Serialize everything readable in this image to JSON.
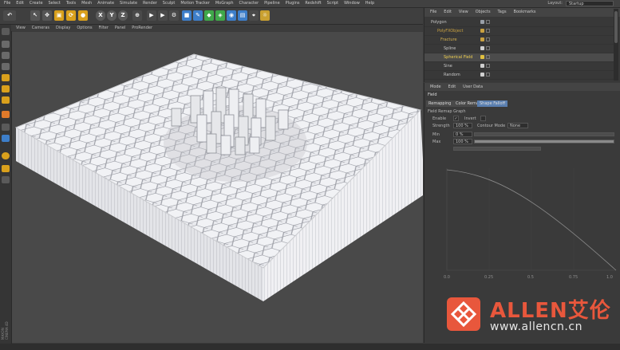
{
  "menubar": {
    "items": [
      "File",
      "Edit",
      "Create",
      "Select",
      "Tools",
      "Mesh",
      "Animate",
      "Simulate",
      "Render",
      "Sculpt",
      "Motion Tracker",
      "MoGraph",
      "Character",
      "Pipeline",
      "Plugins",
      "Redshift",
      "Script",
      "Window",
      "Help"
    ],
    "layout_label": "Layout:",
    "layout_value": "Startup"
  },
  "toolbar": {
    "axis_labels": [
      "X",
      "Y",
      "Z"
    ]
  },
  "viewport_menu": {
    "items": [
      "View",
      "Cameras",
      "Display",
      "Options",
      "Filter",
      "Panel",
      "ProRender"
    ]
  },
  "object_manager": {
    "menu": [
      "File",
      "Edit",
      "View",
      "Objects",
      "Tags",
      "Bookmarks"
    ],
    "objects": [
      {
        "name": "Polygon",
        "color": "#9aa0a8"
      },
      {
        "name": "PolyFXObject",
        "color": "#c8a040"
      },
      {
        "name": "Fracture",
        "color": "#c8a040"
      },
      {
        "name": "Spline",
        "color": "#d0d0d0"
      },
      {
        "name": "Spherical Field",
        "color": "#e0c040"
      },
      {
        "name": "Sine",
        "color": "#cfcfcf"
      },
      {
        "name": "Random",
        "color": "#cfcfcf"
      }
    ]
  },
  "attribute_manager": {
    "menu": [
      "Mode",
      "Edit",
      "User Data"
    ],
    "object_title": "Field",
    "tabs": [
      "Remapping",
      "Color Remap",
      "Shape Falloff"
    ],
    "section": "Field Remap Graph",
    "fields": [
      {
        "label": "Enable",
        "value": "✓"
      },
      {
        "label": "Invert",
        "value": ""
      },
      {
        "label": "Strength",
        "value": "100 %"
      },
      {
        "label": "Contour Mode",
        "value": "None"
      },
      {
        "label": "Min",
        "value": "0 %"
      },
      {
        "label": "Max",
        "value": "100 %"
      }
    ],
    "graph_ticks": [
      "0.0",
      "0.25",
      "0.5",
      "0.75",
      "1.0"
    ]
  },
  "watermark": {
    "brand": "ALLEN艾伦",
    "url": "www.allencn.cn"
  },
  "side_brand": "MAXON CINEMA 4D",
  "colors": {
    "accent": "#e8573c",
    "tool_active": "#d9a01c",
    "tool_blue": "#3d7ec9",
    "viewport_bg": "#494949"
  }
}
